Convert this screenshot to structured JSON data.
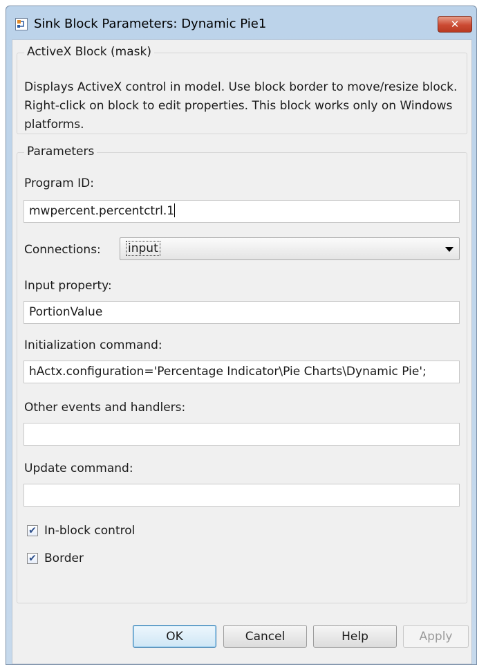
{
  "window": {
    "title": "Sink Block Parameters: Dynamic Pie1",
    "close_glyph": "✕"
  },
  "block": {
    "group_title": "ActiveX Block (mask)",
    "description": "Displays ActiveX control in model. Use block border to move/resize block. Right-click on block to edit properties. This block works only on Windows platforms."
  },
  "parameters": {
    "group_title": "Parameters",
    "program_id": {
      "label": "Program ID:",
      "value": "mwpercent.percentctrl.1"
    },
    "connections": {
      "label": "Connections:",
      "value": "input"
    },
    "input_property": {
      "label": "Input property:",
      "value": "PortionValue"
    },
    "init_command": {
      "label": "Initialization command:",
      "value": "hActx.configuration='Percentage Indicator\\Pie Charts\\Dynamic Pie';"
    },
    "other_events": {
      "label": "Other events and handlers:",
      "value": ""
    },
    "update_command": {
      "label": "Update command:",
      "value": ""
    },
    "in_block_control": {
      "label": "In-block control",
      "checked": true
    },
    "border": {
      "label": "Border",
      "checked": true
    }
  },
  "buttons": {
    "ok": "OK",
    "cancel": "Cancel",
    "help": "Help",
    "apply": "Apply"
  },
  "icons": {
    "app": "simulink-block-icon",
    "close": "close-icon",
    "dropdown": "chevron-down-icon",
    "check": "checkmark-icon"
  }
}
